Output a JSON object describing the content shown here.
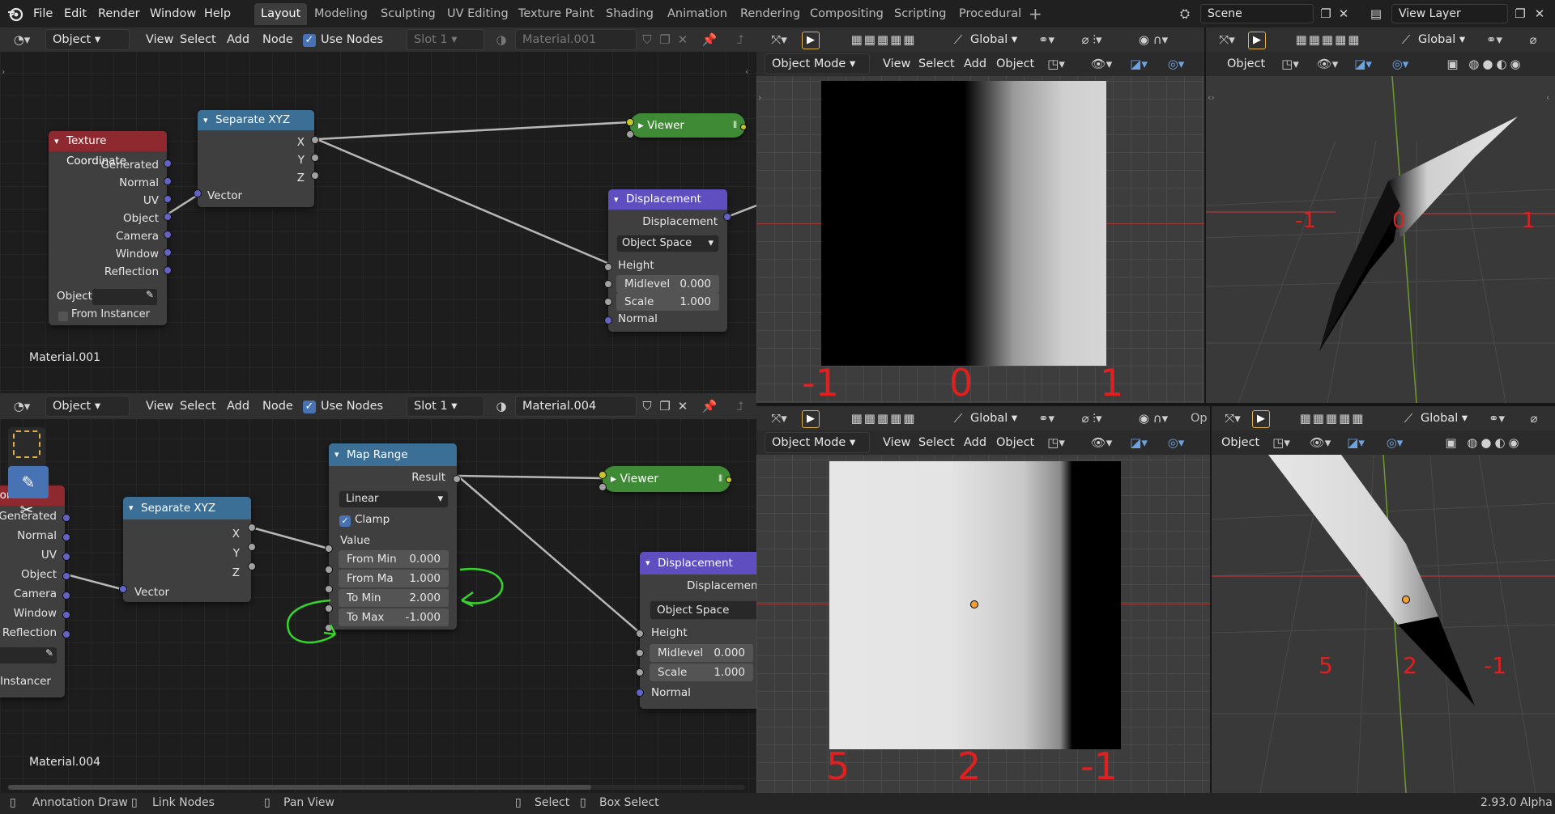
{
  "menu": [
    "File",
    "Edit",
    "Render",
    "Window",
    "Help"
  ],
  "workspace_tabs": [
    "Layout",
    "Modeling",
    "Sculpting",
    "UV Editing",
    "Texture Paint",
    "Shading",
    "Animation",
    "Rendering",
    "Compositing",
    "Scripting",
    "Procedural"
  ],
  "active_tab": "Layout",
  "scene": "Scene",
  "view_layer": "View Layer",
  "editor_top": {
    "mode": "Object",
    "menus": [
      "View",
      "Select",
      "Add",
      "Node"
    ],
    "use_nodes": "Use Nodes",
    "slot": "Slot 1",
    "material": "Material.001",
    "material_label": "Material.001"
  },
  "editor_bottom": {
    "mode": "Object",
    "menus": [
      "View",
      "Select",
      "Add",
      "Node"
    ],
    "use_nodes": "Use Nodes",
    "slot": "Slot 1",
    "material": "Material.004",
    "material_label": "Material.004"
  },
  "nodes_top": {
    "texcoord": {
      "title": "Texture Coordinate",
      "outputs": [
        "Generated",
        "Normal",
        "UV",
        "Object",
        "Camera",
        "Window",
        "Reflection"
      ],
      "object_label": "Object:",
      "from_instancer": "From Instancer"
    },
    "separate": {
      "title": "Separate XYZ",
      "outputs": [
        "X",
        "Y",
        "Z"
      ],
      "input": "Vector"
    },
    "viewer": {
      "title": "Viewer"
    },
    "displacement": {
      "title": "Displacement",
      "output": "Displacement",
      "space": "Object Space",
      "height": "Height",
      "midlevel_label": "Midlevel",
      "midlevel": "0.000",
      "scale_label": "Scale",
      "scale": "1.000",
      "normal": "Normal"
    }
  },
  "nodes_bottom": {
    "texcoord": {
      "title": "Coordinate",
      "outputs": [
        "Generated",
        "Normal",
        "UV",
        "Object",
        "Camera",
        "Window",
        "Reflection"
      ],
      "from_instancer": "Instancer"
    },
    "separate": {
      "title": "Separate XYZ",
      "outputs": [
        "X",
        "Y",
        "Z"
      ],
      "input": "Vector"
    },
    "maprange": {
      "title": "Map Range",
      "result": "Result",
      "interp": "Linear",
      "clamp": "Clamp",
      "value": "Value",
      "from_min_label": "From Min",
      "from_min": "0.000",
      "from_max_label": "From Ma",
      "from_max": "1.000",
      "to_min_label": "To Min",
      "to_min": "2.000",
      "to_max_label": "To Max",
      "to_max": "-1.000"
    },
    "viewer": {
      "title": "Viewer"
    },
    "displacement": {
      "title": "Displacement",
      "output": "Displacemen",
      "space": "Object Space",
      "height": "Height",
      "midlevel_label": "Midlevel",
      "midlevel": "0.000",
      "scale_label": "Scale",
      "scale": "1.000",
      "normal": "Normal"
    }
  },
  "viewport": {
    "transform": "Global",
    "mode": "Object Mode",
    "menus": [
      "View",
      "Select",
      "Add",
      "Object"
    ],
    "object_short": "Object",
    "op": "Op"
  },
  "labels_top_left": [
    "-1",
    "0",
    "1"
  ],
  "labels_top_right": [
    "-1",
    "0",
    "1"
  ],
  "labels_bottom_left": [
    "5",
    "2",
    "-1"
  ],
  "labels_bottom_right": [
    "5",
    "2",
    "-1"
  ],
  "status": {
    "annotate": "Annotation Draw",
    "link": "Link Nodes",
    "pan": "Pan View",
    "select": "Select",
    "box": "Box Select",
    "version": "2.93.0 Alpha"
  },
  "colors": {
    "texcoord_header": "#8e2a2f",
    "vector_header": "#3b6f95",
    "viewer": "#3f8a35",
    "displacement_header": "#5f4ec0",
    "maprange_header": "#3b6f95",
    "annotation": "#37d52c",
    "axis_red": "#e02020"
  }
}
